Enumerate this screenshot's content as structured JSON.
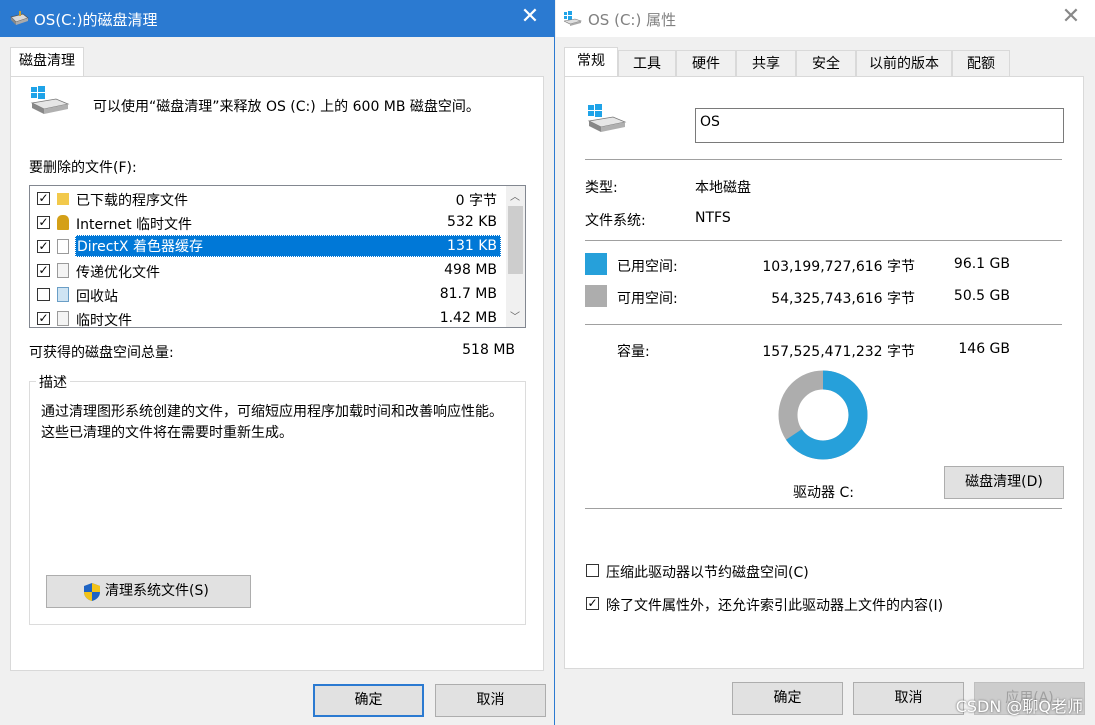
{
  "cleanup_window": {
    "title": "OS(C:)的磁盘清理",
    "tab": "磁盘清理",
    "intro": "可以使用“磁盘清理”来释放 OS (C:) 上的 600 MB 磁盘空间。",
    "files_label": "要删除的文件(F):",
    "files": [
      {
        "label": "已下载的程序文件",
        "size": "0 字节",
        "checked": true,
        "icon": "folder-icon"
      },
      {
        "label": "Internet 临时文件",
        "size": "532 KB",
        "checked": true,
        "icon": "lock-icon"
      },
      {
        "label": "DirectX 着色器缓存",
        "size": "131 KB",
        "checked": true,
        "icon": "file-icon"
      },
      {
        "label": "传递优化文件",
        "size": "498 MB",
        "checked": true,
        "icon": "file-icon"
      },
      {
        "label": "回收站",
        "size": "81.7 MB",
        "checked": false,
        "icon": "recycle-bin-icon"
      },
      {
        "label": "临时文件",
        "size": "1.42 MB",
        "checked": true,
        "icon": "file-icon"
      }
    ],
    "total_label": "可获得的磁盘空间总量:",
    "total_value": "518 MB",
    "description_title": "描述",
    "description": "通过清理图形系统创建的文件，可缩短应用程序加载时间和改善响应性能。这些已清理的文件将在需要时重新生成。",
    "cleanup_system_button": "清理系统文件(S)",
    "ok_button": "确定",
    "cancel_button": "取消"
  },
  "properties_window": {
    "title": "OS (C:) 属性",
    "tabs": [
      "常规",
      "工具",
      "硬件",
      "共享",
      "安全",
      "以前的版本",
      "配额"
    ],
    "drive_name": "OS",
    "type_label": "类型:",
    "type_value": "本地磁盘",
    "fs_label": "文件系统:",
    "fs_value": "NTFS",
    "used_label": "已用空间:",
    "used_bytes": "103,199,727,616 字节",
    "used_gb": "96.1 GB",
    "free_label": "可用空间:",
    "free_bytes": "54,325,743,616 字节",
    "free_gb": "50.5 GB",
    "capacity_label": "容量:",
    "capacity_bytes": "157,525,471,232 字节",
    "capacity_gb": "146 GB",
    "drive_label": "驱动器 C:",
    "disk_cleanup_button": "磁盘清理(D)",
    "compress_label": "压缩此驱动器以节约磁盘空间(C)",
    "compress_checked": false,
    "index_label": "除了文件属性外，还允许索引此驱动器上文件的内容(I)",
    "index_checked": true,
    "ok_button": "确定",
    "cancel_button": "取消",
    "apply_button": "应用(A)",
    "used_fraction": 0.655,
    "used_color": "#26a0da",
    "free_color": "#adadad"
  },
  "watermark": "CSDN @聊Q老师"
}
